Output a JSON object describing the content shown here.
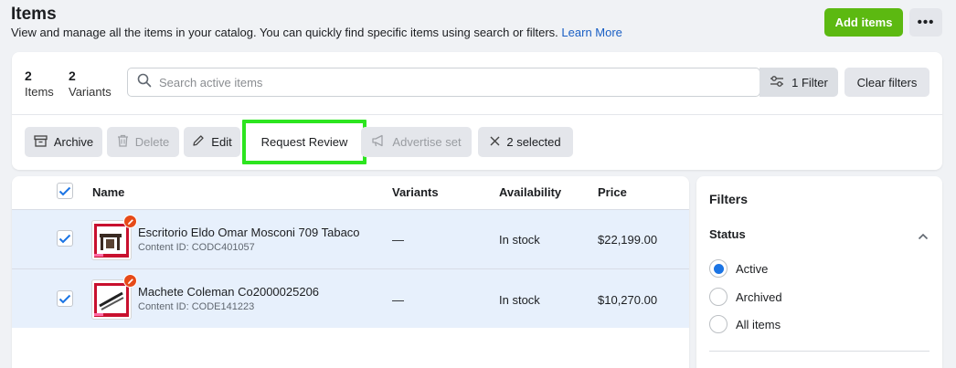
{
  "header": {
    "title": "Items",
    "description": "View and manage all the items in your catalog. You can quickly find specific items using search or filters.",
    "learn_more": "Learn More",
    "add_button": "Add items",
    "more_button": "•••"
  },
  "stats": {
    "items_count": "2",
    "items_label": "Items",
    "variants_count": "2",
    "variants_label": "Variants"
  },
  "search": {
    "placeholder": "Search active items",
    "value": ""
  },
  "filter_button": "1 Filter",
  "clear_filters": "Clear filters",
  "toolbar": {
    "archive": "Archive",
    "delete": "Delete",
    "edit": "Edit",
    "request_review": "Request Review",
    "advertise_set": "Advertise set",
    "selected": "2 selected"
  },
  "table": {
    "columns": {
      "name": "Name",
      "variants": "Variants",
      "availability": "Availability",
      "price": "Price"
    },
    "rows": [
      {
        "name": "Escritorio Eldo Omar Mosconi 709 Tabaco",
        "content_id": "Content ID: CODC401057",
        "variants": "—",
        "availability": "In stock",
        "price": "$22,199.00",
        "checked": true
      },
      {
        "name": "Machete Coleman Co2000025206",
        "content_id": "Content ID: CODE141223",
        "variants": "—",
        "availability": "In stock",
        "price": "$10,270.00",
        "checked": true
      }
    ]
  },
  "filters": {
    "title": "Filters",
    "status_label": "Status",
    "options": [
      "Active",
      "Archived",
      "All items"
    ],
    "selected": "Active"
  },
  "colors": {
    "primary_green": "#5cb911",
    "link_blue": "#1a5fc4",
    "selection_blue": "#1b74e4",
    "row_highlight": "#e7f0fc",
    "focus_outline": "#2ce51f"
  }
}
